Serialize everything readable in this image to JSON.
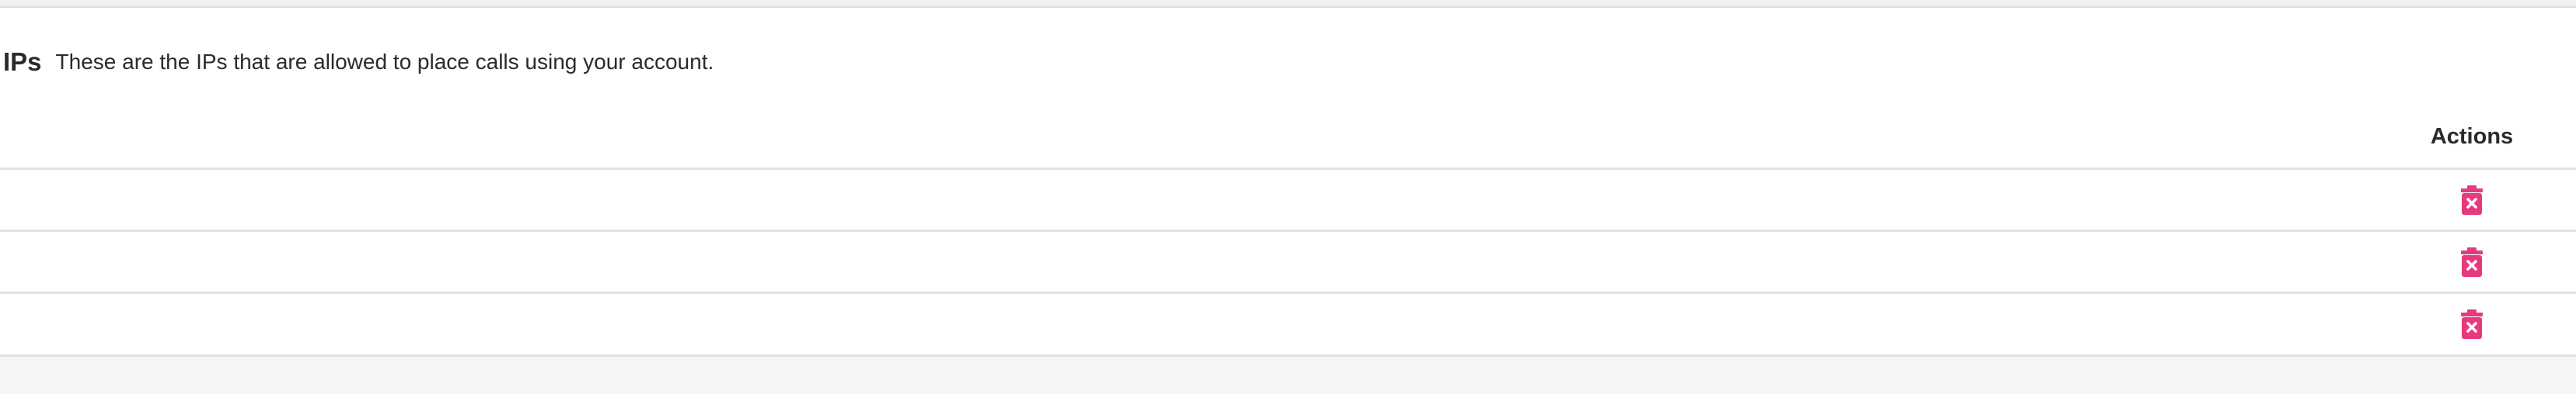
{
  "section": {
    "title": "IPs",
    "description": "These are the IPs that are allowed to place calls using your account."
  },
  "table": {
    "columns": [
      "Actions"
    ],
    "rows": [
      {
        "action_icon": "trash-delete-icon"
      },
      {
        "action_icon": "trash-delete-icon"
      },
      {
        "action_icon": "trash-delete-icon"
      }
    ]
  },
  "colors": {
    "accent": "#e6397f"
  }
}
